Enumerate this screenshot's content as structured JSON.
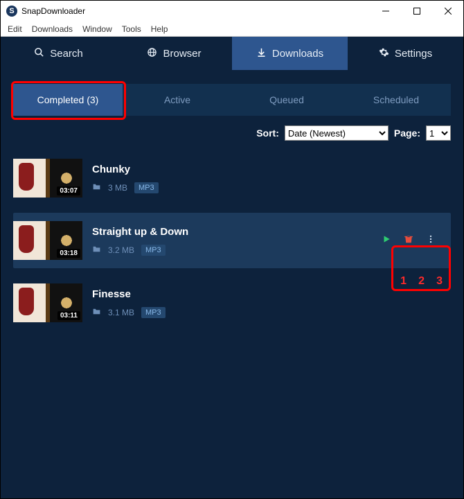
{
  "app": {
    "title": "SnapDownloader"
  },
  "menubar": [
    "Edit",
    "Downloads",
    "Window",
    "Tools",
    "Help"
  ],
  "main_tabs": [
    {
      "label": "Search",
      "icon": "search-icon"
    },
    {
      "label": "Browser",
      "icon": "globe-icon"
    },
    {
      "label": "Downloads",
      "icon": "download-icon",
      "active": true
    },
    {
      "label": "Settings",
      "icon": "gear-icon"
    }
  ],
  "sub_tabs": [
    {
      "label": "Completed (3)",
      "active": true
    },
    {
      "label": "Active"
    },
    {
      "label": "Queued"
    },
    {
      "label": "Scheduled"
    }
  ],
  "sort": {
    "label": "Sort:",
    "value": "Date (Newest)",
    "page_label": "Page:",
    "page_value": "1"
  },
  "items": [
    {
      "title": "Chunky",
      "duration": "03:07",
      "size": "3 MB",
      "format": "MP3"
    },
    {
      "title": "Straight up & Down",
      "duration": "03:18",
      "size": "3.2 MB",
      "format": "MP3",
      "hover": true
    },
    {
      "title": "Finesse",
      "duration": "03:11",
      "size": "3.1 MB",
      "format": "MP3"
    }
  ],
  "annotations": {
    "n1": "1",
    "n2": "2",
    "n3": "3"
  }
}
